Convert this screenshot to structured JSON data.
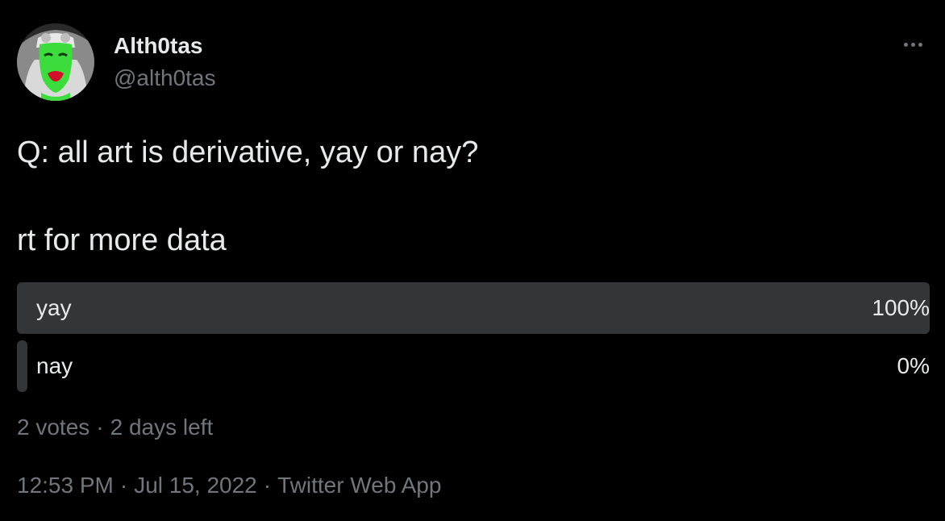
{
  "author": {
    "display_name": "Alth0tas",
    "handle": "@alth0tas",
    "avatar_icon": "green-face-avatar"
  },
  "more_icon": "more-horizontal-icon",
  "tweet": {
    "line1": "Q: all art is derivative, yay or nay?",
    "line2": "rt for more data"
  },
  "poll": {
    "options": [
      {
        "label": "yay",
        "percent_text": "100%",
        "fraction": 1.0
      },
      {
        "label": "nay",
        "percent_text": "0%",
        "fraction": 0.0
      }
    ],
    "votes": "2 votes",
    "time_left": "2 days left",
    "separator": "·"
  },
  "footer": {
    "time": "12:53 PM",
    "date": "Jul 15, 2022",
    "source": "Twitter Web App",
    "separator": "·"
  },
  "colors": {
    "background": "#000000",
    "primary_text": "#e7e9ea",
    "secondary_text": "#71767b",
    "poll_bar": "#333639"
  }
}
